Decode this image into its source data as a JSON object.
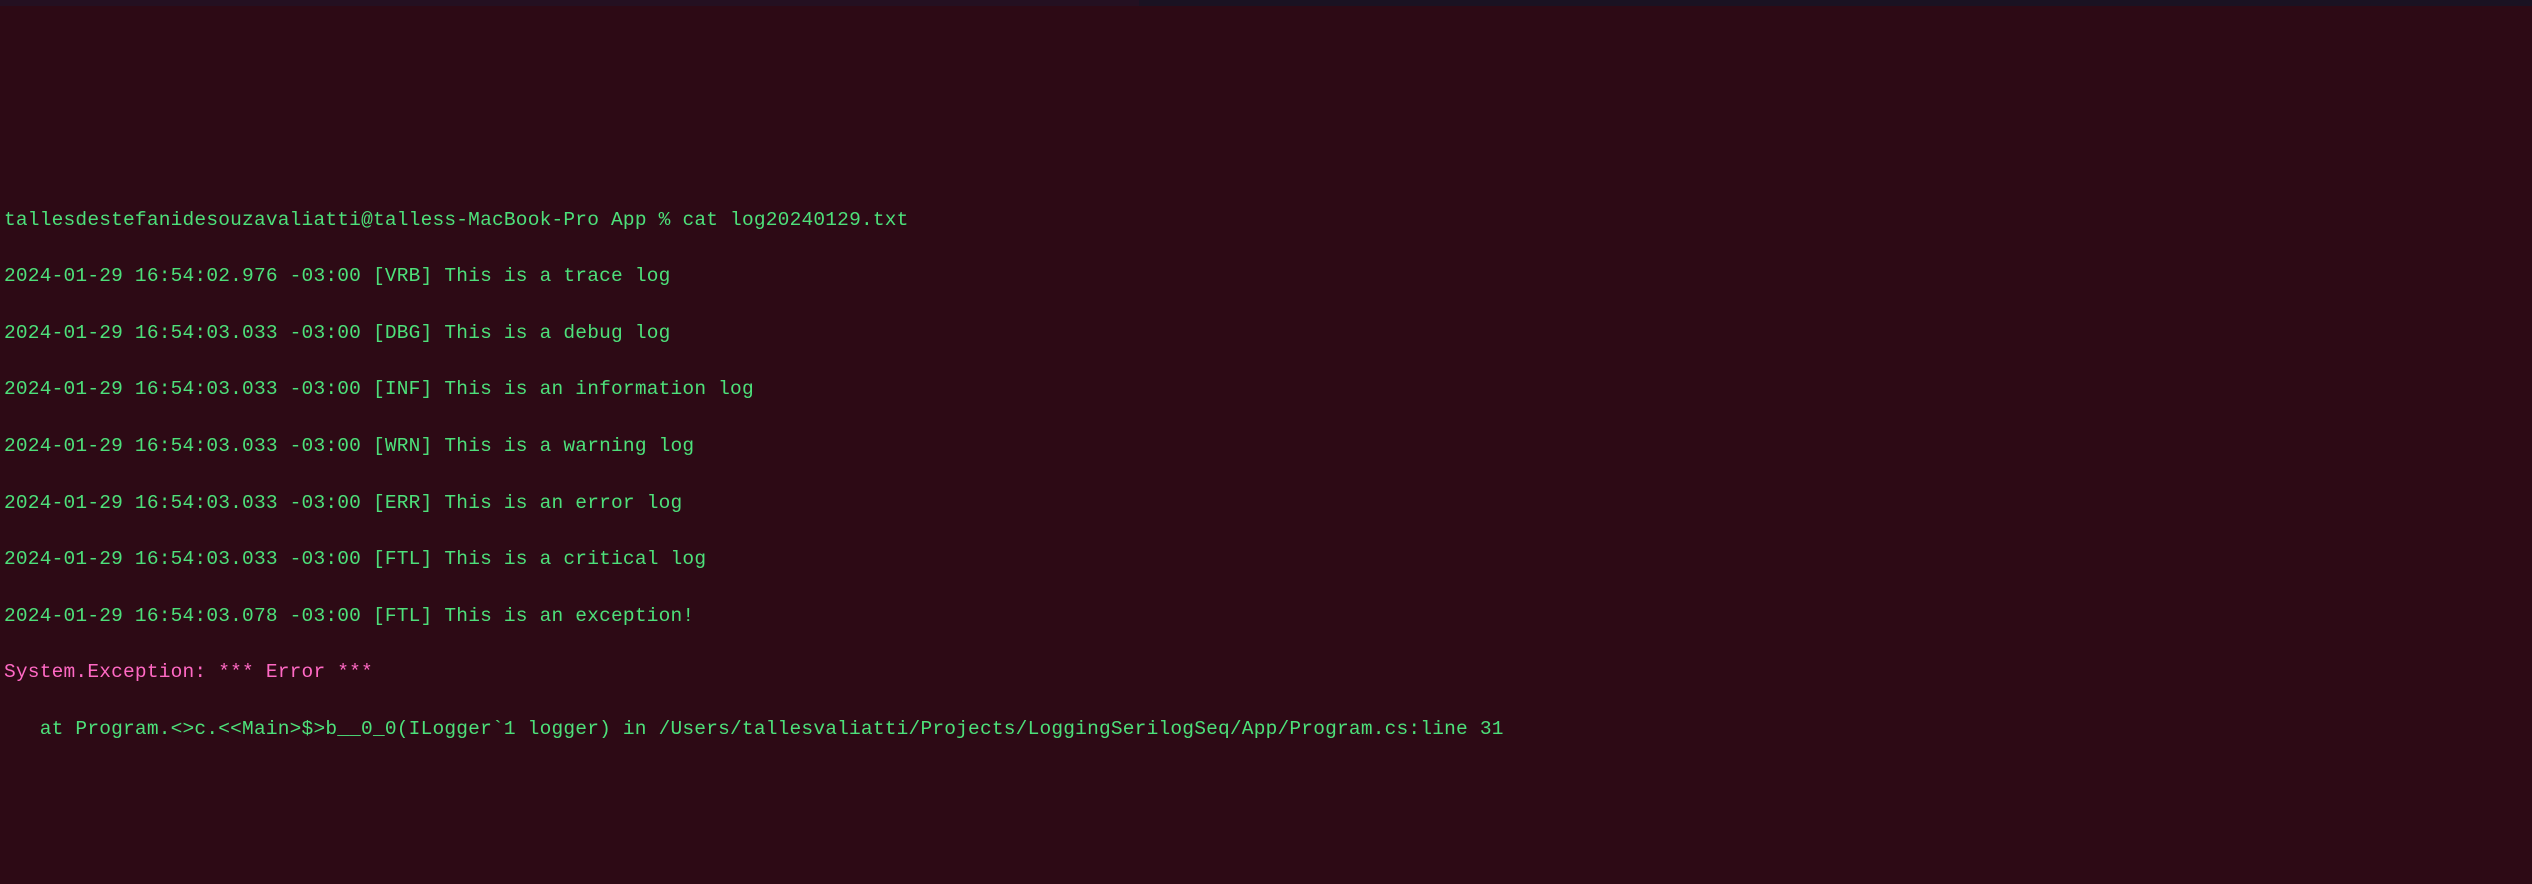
{
  "prompt": {
    "user": "tallesdestefanidesouzavaliatti",
    "host": "talless-MacBook-Pro",
    "dir": "App",
    "symbol": "%",
    "command": "cat log20240129.txt"
  },
  "logs": [
    {
      "ts": "2024-01-29 16:54:02.976 -03:00",
      "level": "[VRB]",
      "msg": "This is a trace log"
    },
    {
      "ts": "2024-01-29 16:54:03.033 -03:00",
      "level": "[DBG]",
      "msg": "This is a debug log"
    },
    {
      "ts": "2024-01-29 16:54:03.033 -03:00",
      "level": "[INF]",
      "msg": "This is an information log"
    },
    {
      "ts": "2024-01-29 16:54:03.033 -03:00",
      "level": "[WRN]",
      "msg": "This is a warning log"
    },
    {
      "ts": "2024-01-29 16:54:03.033 -03:00",
      "level": "[ERR]",
      "msg": "This is an error log"
    },
    {
      "ts": "2024-01-29 16:54:03.033 -03:00",
      "level": "[FTL]",
      "msg": "This is a critical log"
    },
    {
      "ts": "2024-01-29 16:54:03.078 -03:00",
      "level": "[FTL]",
      "msg": "This is an exception!"
    }
  ],
  "exception": {
    "header": "System.Exception: *** Error ***",
    "stack": "   at Program.<>c.<<Main>$>b__0_0(ILogger`1 logger) in /Users/tallesvaliatti/Projects/LoggingSerilogSeq/App/Program.cs:line 31"
  }
}
